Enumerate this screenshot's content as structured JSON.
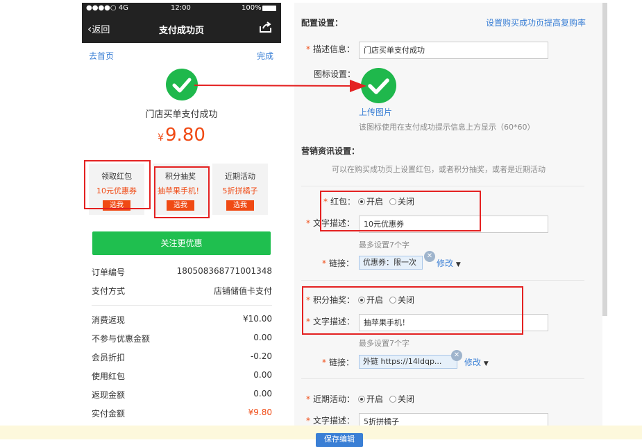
{
  "status_bar": {
    "signal": "●●●●○ 4G",
    "time": "12:00",
    "battery": "100%"
  },
  "nav": {
    "back": "返回",
    "title": "支付成功页"
  },
  "links": {
    "home": "去首页",
    "done": "完成"
  },
  "success": {
    "message": "门店买单支付成功",
    "currency": "¥",
    "amount": "9.80"
  },
  "promos": [
    {
      "title": "领取红包",
      "subtitle": "10元优惠券",
      "button": "选我"
    },
    {
      "title": "积分抽奖",
      "subtitle": "抽苹果手机！",
      "button": "选我"
    },
    {
      "title": "近期活动",
      "subtitle": "5折拼橘子",
      "button": "选我"
    }
  ],
  "follow_button": "关注更优惠",
  "order": {
    "rows": [
      {
        "label": "订单编号",
        "value": "180508368771001348"
      },
      {
        "label": "支付方式",
        "value": "店铺储值卡支付"
      },
      {
        "label": "消费返现",
        "value": "¥10.00"
      },
      {
        "label": "不参与优惠金额",
        "value": "0.00"
      },
      {
        "label": "会员折扣",
        "value": "-0.20"
      },
      {
        "label": "使用红包",
        "value": "0.00"
      },
      {
        "label": "返现金额",
        "value": "0.00"
      },
      {
        "label": "实付金额",
        "value": "¥9.80"
      }
    ]
  },
  "config": {
    "section_title": "配置设置：",
    "top_link": "设置购买成功页提高复购率",
    "desc_label": "描述信息：",
    "desc_value": "门店买单支付成功",
    "icon_label": "图标设置：",
    "upload_link": "上传图片",
    "icon_hint": "该图标使用在支付成功提示信息上方显示（60*60）",
    "marketing_title": "营销资讯设置：",
    "marketing_hint": "可以在购买成功页上设置红包，或者积分抽奖，或者是近期活动",
    "on_label": "开启",
    "off_label": "关闭",
    "text_desc_label": "文字描述：",
    "max_hint": "最多设置7个字",
    "link_label": "链接：",
    "modify": "修改",
    "redpacket": {
      "label": "红包：",
      "text": "10元优惠券",
      "link": "优惠券：限一次"
    },
    "lottery": {
      "label": "积分抽奖：",
      "text": "抽苹果手机！",
      "link": "外链 https://14ldqp..."
    },
    "recent": {
      "label": "近期活动：",
      "text": "5折拼橘子"
    },
    "save": "保存编辑"
  },
  "colors": {
    "accent_green": "#1fb84c",
    "price_red": "#f04a14",
    "link_blue": "#3a7fd5",
    "annotation_red": "#e42121"
  }
}
